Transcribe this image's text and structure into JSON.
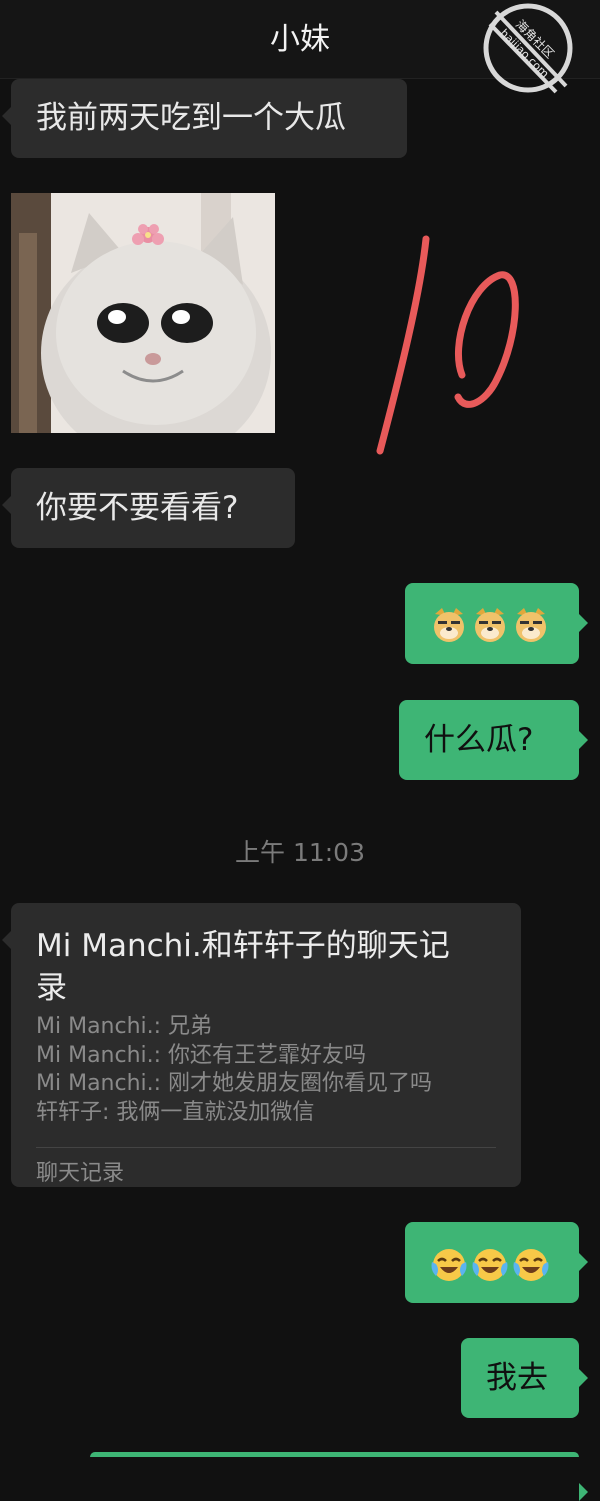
{
  "header": {
    "title": "小妹"
  },
  "watermark": {
    "line1": "海角社区",
    "line2": "haijiao.com"
  },
  "messages": {
    "m1": "我前两天吃到一个大瓜",
    "m2": "你要不要看看?",
    "m4": "什么瓜?",
    "m6": "我去"
  },
  "timestamp": "上午 11:03",
  "chat_record": {
    "title": "Mi Manchi.和轩轩子的聊天记录",
    "lines": [
      "Mi Manchi.: 兄弟",
      "Mi Manchi.: 你还有王艺霏好友吗",
      "Mi Manchi.: 刚才她发朋友圈你看见了吗",
      "轩轩子: 我俩一直就没加微信"
    ],
    "footer": "聊天记录"
  },
  "emoji_messages": {
    "m3": [
      "doge-emoji",
      "doge-emoji",
      "doge-emoji"
    ],
    "m5": [
      "laugh-cry-emoji",
      "laugh-cry-emoji",
      "laugh-cry-emoji"
    ]
  },
  "colors": {
    "background": "#111111",
    "incoming_bubble": "#2c2c2c",
    "outgoing_bubble": "#3eb575",
    "annotation_red": "#e85a5a"
  }
}
